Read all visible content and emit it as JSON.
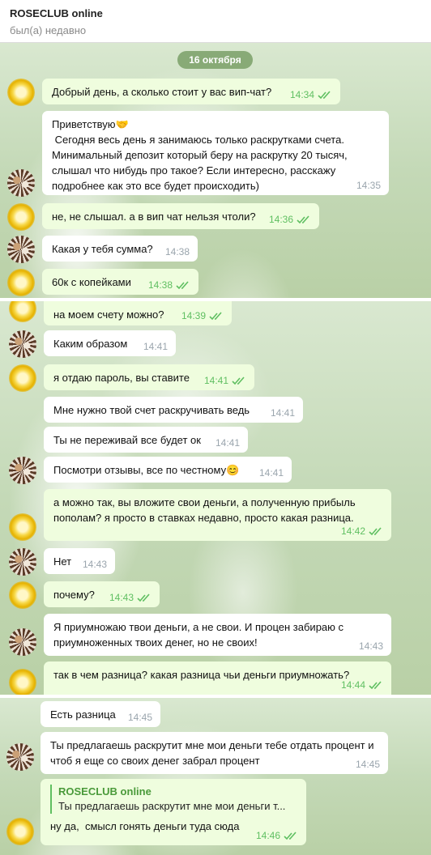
{
  "header": {
    "title": "ROSECLUB online",
    "status": "был(а) недавно"
  },
  "date_label": "16 октября",
  "messages": [
    {
      "text": "Добрый день, а сколько стоит у вас вип-чат?",
      "time": "14:34"
    },
    {
      "text": "Приветствую🤝\n Сегодня весь день я занимаюсь только раскрутками счета. Минимальный депозит который беру на раскрутку 20 тысяч, слышал что нибудь про такое? Если интересно, расскажу подробнее как это все будет происходить)",
      "time": "14:35"
    },
    {
      "text": "не, не слышал. а в вип чат нельзя чтоли?",
      "time": "14:36"
    },
    {
      "text": "Какая у тебя сумма?",
      "time": "14:38"
    },
    {
      "text": "60к с копейками",
      "time": "14:38"
    },
    {
      "text": "на моем счету можно?",
      "time": "14:39"
    },
    {
      "text": "Каким образом",
      "time": "14:41"
    },
    {
      "text": "я отдаю пароль, вы ставите",
      "time": "14:41"
    },
    {
      "text": "Мне нужно твой счет раскручивать ведь",
      "time": "14:41"
    },
    {
      "text": "Ты не переживай все будет ок",
      "time": "14:41"
    },
    {
      "text": "Посмотри отзывы, все по честному😊",
      "time": "14:41"
    },
    {
      "text": "а можно так, вы вложите свои деньги, а полученную прибыль пополам? я просто в ставках недавно, просто какая разница.",
      "time": "14:42"
    },
    {
      "text": "Нет",
      "time": "14:43"
    },
    {
      "text": "почему?",
      "time": "14:43"
    },
    {
      "text": "Я приумножаю твои деньги, а не свои. И процен забираю с приумноженных твоих денег, но не своих!",
      "time": "14:43"
    },
    {
      "text": "так в чем разница? какая разница чьи деньги приумножать?",
      "time": "14:44"
    },
    {
      "text": "Есть разница",
      "time": "14:45"
    },
    {
      "text": "Ты предлагаешь раскрутит мне мои деньги тебе отдать процент и чтоб я еще со своих денег забрал процент",
      "time": "14:45"
    },
    {
      "text": "ну да,  смысл гонять деньги туда сюда",
      "time": "14:46",
      "reply_name": "ROSECLUB online",
      "reply_text": "Ты предлагаешь раскрутит мне мои деньги т..."
    }
  ],
  "colors": {
    "incoming": "#ffffff",
    "outgoing": "#effdde",
    "check": "#5fbf61",
    "time": "#9aa5ad"
  },
  "icons": {
    "read_receipt": "double-check-icon",
    "avatar_user": "sun-avatar",
    "avatar_peer": "flower-avatar"
  }
}
